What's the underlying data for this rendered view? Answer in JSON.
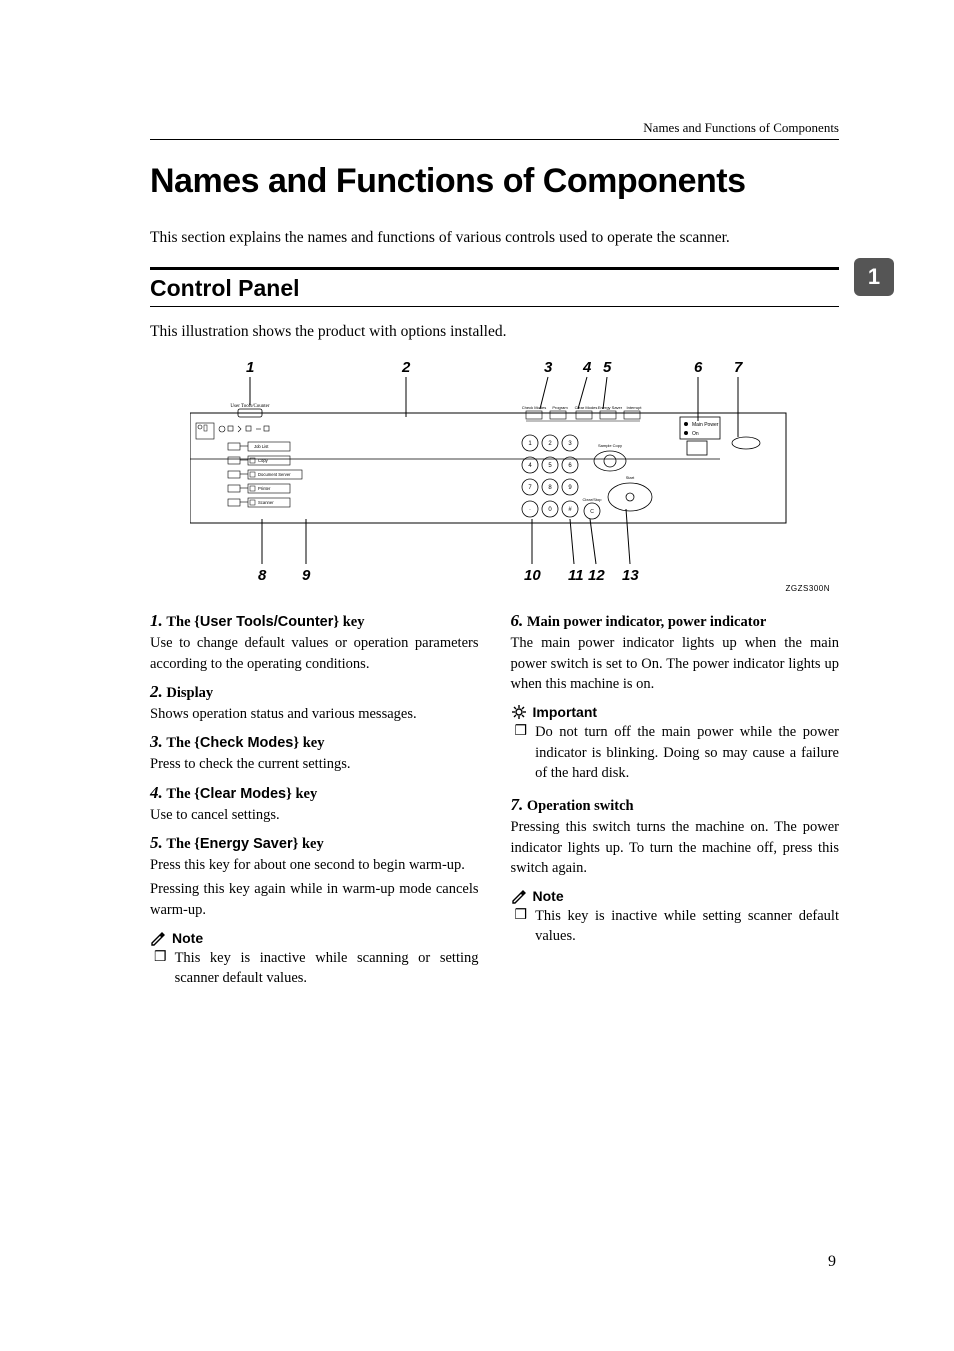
{
  "running_header": "Names and Functions of Components",
  "h1": "Names and Functions of Components",
  "intro": "This section explains the names and functions of various controls used to operate the scanner.",
  "chapter_tab": "1",
  "h2": "Control Panel",
  "caption": "This illustration shows the product with options installed.",
  "figure": {
    "callouts_top": [
      "1",
      "2",
      "3",
      "4",
      "5",
      "6",
      "7"
    ],
    "callouts_bottom": [
      "8",
      "9",
      "10",
      "11",
      "12",
      "13"
    ],
    "panel_labels": {
      "user_tools": "User Tools/Counter",
      "job_list": "Job List",
      "copy": "Copy",
      "doc_server": "Document Server",
      "printer": "Printer",
      "scanner": "Scanner",
      "check_modes": "Check Modes",
      "program": "Program",
      "clear_modes": "Clear Modes",
      "energy_saver": "Energy Saver",
      "interrupt": "Interrupt",
      "main_power": "Main Power",
      "on": "On",
      "sample_copy": "Sample Copy",
      "start": "Start",
      "clear_stop": "Clear/Stop"
    },
    "id": "ZGZS300N"
  },
  "left_col": [
    {
      "num": "1.",
      "title_before_key": "The ",
      "key": "User Tools/Counter",
      "title_after_key": " key",
      "body": "Use to change default values or operation parameters according to the operating conditions."
    },
    {
      "num": "2.",
      "title_plain": "Display",
      "body": "Shows operation status and various messages."
    },
    {
      "num": "3.",
      "title_before_key": "The ",
      "key": "Check Modes",
      "title_after_key": " key",
      "body": "Press to check the current settings."
    },
    {
      "num": "4.",
      "title_before_key": "The ",
      "key": "Clear Modes",
      "title_after_key": " key",
      "body": "Use to cancel settings."
    },
    {
      "num": "5.",
      "title_before_key": "The ",
      "key": "Energy Saver",
      "title_after_key": " key",
      "body": "Press this key for about one second to begin warm-up.",
      "body2": "Pressing this key again while in warm-up mode cancels warm-up.",
      "note": {
        "label": "Note",
        "text": "This key is inactive while scanning or setting scanner default values."
      }
    }
  ],
  "right_col": [
    {
      "num": "6.",
      "title_plain": "Main power indicator, power indicator",
      "body": "The main power indicator lights up when the main power switch is set to On. The power indicator lights up when this machine is on.",
      "important": {
        "label": "Important",
        "text": "Do not turn off the main power while the power indicator is blinking. Doing so may cause a failure of the hard disk."
      }
    },
    {
      "num": "7.",
      "title_plain": "Operation switch",
      "body": "Pressing this switch turns the machine on. The power indicator lights up. To turn the machine off, press this switch again.",
      "note": {
        "label": "Note",
        "text": "This key is inactive while setting scanner default values."
      }
    }
  ],
  "page_number": "9"
}
